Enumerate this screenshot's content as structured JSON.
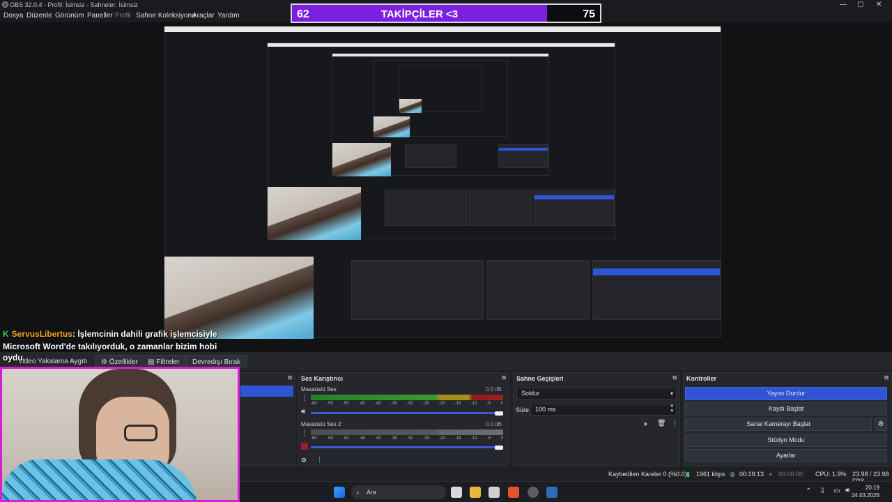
{
  "window": {
    "title": "OBS 32.0.4 - Profil: İsimsiz - Sahneler: İsimsiz",
    "controls": [
      "—",
      "▢",
      "✕"
    ]
  },
  "menu": {
    "items": [
      "Dosya",
      "Düzenle",
      "Görünüm",
      "Paneller",
      "Profil",
      "Sahne Koleksiyonu",
      "Araçlar",
      "Yardım"
    ]
  },
  "follower_bar": {
    "current": "62",
    "label": "TAKİPÇİLER <3",
    "goal": "75",
    "progress": 0.827,
    "color": "#7b1fe0"
  },
  "chat": {
    "username": "ServusLibertus",
    "message": ": İşlemcinin dahili grafik işlemcisiyle Microsoft Word'de takılıyorduk, o zamanlar bizim hobi",
    "overflow": "oydu."
  },
  "source_toolbar": {
    "device_label": "Video Yakalama Aygıtı",
    "properties_label": "Özellikler",
    "filters_label": "Filtreler",
    "deactivate_label": "Devredışı Bırak"
  },
  "audio_mixer": {
    "title": "Ses Karıştırıcı",
    "channels": [
      {
        "name": "Masaüstü Ses",
        "db": "0.0 dB",
        "active": true
      },
      {
        "name": "Masaüstü Ses 2",
        "db": "0.0 dB",
        "active": false
      }
    ],
    "ticks": [
      "-60",
      "-55",
      "-50",
      "-45",
      "-40",
      "-35",
      "-30",
      "-25",
      "-20",
      "-15",
      "-10",
      "-5",
      "0"
    ]
  },
  "transitions": {
    "title": "Sahne Geçişleri",
    "selected": "Soldur",
    "duration_label": "Süre",
    "duration_value": "100 ms"
  },
  "controls": {
    "title": "Kontroller",
    "buttons": [
      "Yayını Durdur",
      "Kaydı Başlat",
      "Sanal Kamerayı Başlat",
      "Stüdyo Modu",
      "Ayarlar"
    ]
  },
  "status": {
    "dropped": "Kaybedilen Kareler 0 (%0.0)",
    "bitrate": "1961 kbps",
    "stream_time": "00:19:13",
    "rec_time": "00:00:00",
    "cpu": "CPU: 1.9%",
    "fps": "23.98 / 23.98 FPS"
  },
  "taskbar": {
    "search_placeholder": "Ara",
    "time": "20:19",
    "date": "24.03.2026"
  },
  "colors": {
    "accent_blue": "#2f55d4",
    "cam_border": "#d81fd0",
    "purple": "#7b1fe0",
    "chat_user": "#f5a623"
  }
}
